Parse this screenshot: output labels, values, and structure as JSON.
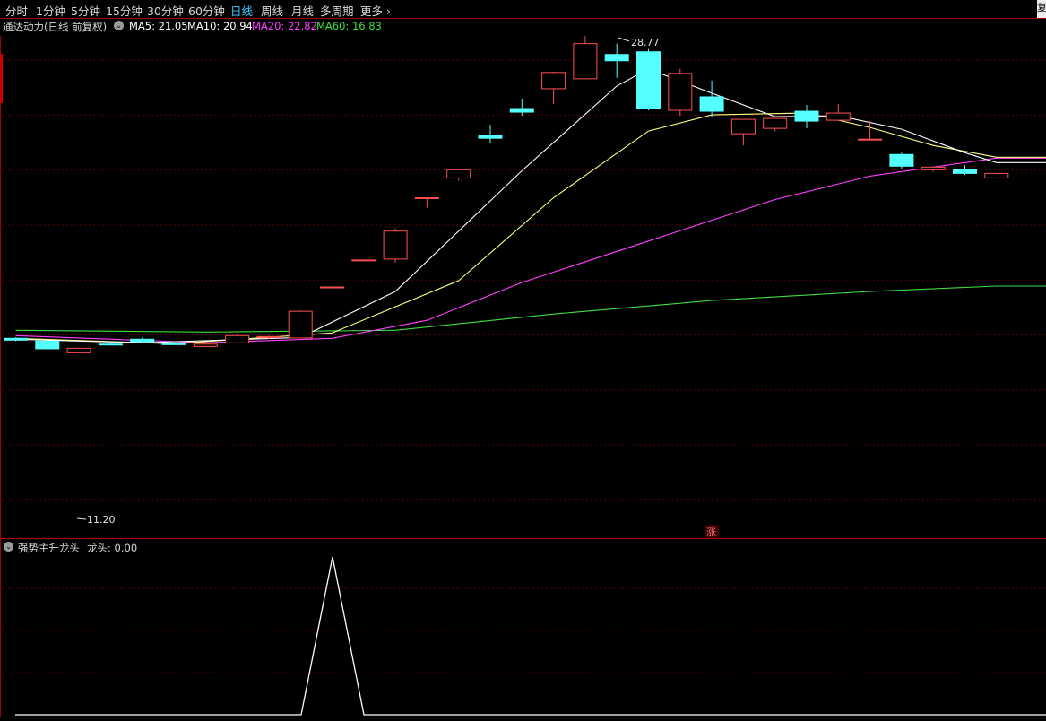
{
  "toolbar": {
    "tabs": [
      "分时",
      "1分钟",
      "5分钟",
      "15分钟",
      "30分钟",
      "60分钟",
      "日线",
      "周线",
      "月线",
      "多周期",
      "更多"
    ],
    "active": "日线",
    "more_chevron": "chevron-right-icon",
    "corner_label": "复"
  },
  "legend": {
    "title": "通达动力(日线 前复权)",
    "toggle_icon": "chevron-down-circle-icon",
    "ma5": "MA5: 21.05",
    "ma10": "MA10: 20.94",
    "ma20": "MA20: 22.82",
    "ma60": "MA60: 16.83"
  },
  "indicator": {
    "title": "强势主升龙头",
    "value": "龙头: 0.00",
    "toggle_icon": "chevron-down-circle-icon"
  },
  "colors": {
    "up": "#ff5050",
    "down": "#54ffff",
    "ma5": "#ffffff",
    "ma10": "#ffff80",
    "ma20": "#ff40ff",
    "ma60": "#40e040",
    "grid": "#5a0000",
    "frame": "#a00000"
  },
  "chart_data": [
    {
      "type": "candlestick",
      "title": "通达动力(日线 前复权)",
      "high_label": "28.77",
      "low_label": "11.20",
      "marker_label": "涨",
      "candles": [
        {
          "o": 12.0,
          "h": 12.05,
          "l": 11.85,
          "c": 11.9
        },
        {
          "o": 11.85,
          "h": 11.9,
          "l": 11.42,
          "c": 11.42
        },
        {
          "o": 11.2,
          "h": 11.48,
          "l": 11.2,
          "c": 11.45
        },
        {
          "o": 11.68,
          "h": 11.72,
          "l": 11.62,
          "c": 11.66
        },
        {
          "o": 11.95,
          "h": 12.05,
          "l": 11.75,
          "c": 11.82
        },
        {
          "o": 11.72,
          "h": 11.75,
          "l": 11.62,
          "c": 11.65
        },
        {
          "o": 11.55,
          "h": 11.72,
          "l": 11.55,
          "c": 11.68
        },
        {
          "o": 11.75,
          "h": 12.2,
          "l": 11.72,
          "c": 12.15
        },
        {
          "o": 12.05,
          "h": 12.15,
          "l": 11.95,
          "c": 12.1
        },
        {
          "o": 12.02,
          "h": 13.55,
          "l": 12.0,
          "c": 13.5
        },
        {
          "o": 14.85,
          "h": 14.85,
          "l": 14.85,
          "c": 14.85
        },
        {
          "o": 16.35,
          "h": 16.35,
          "l": 16.35,
          "c": 16.35
        },
        {
          "o": 16.4,
          "h": 18.1,
          "l": 16.2,
          "c": 17.95
        },
        {
          "o": 19.8,
          "h": 19.8,
          "l": 19.25,
          "c": 19.8
        },
        {
          "o": 20.9,
          "h": 21.4,
          "l": 20.75,
          "c": 21.35
        },
        {
          "o": 23.25,
          "h": 23.85,
          "l": 22.8,
          "c": 23.1
        },
        {
          "o": 24.75,
          "h": 25.3,
          "l": 24.35,
          "c": 24.55
        },
        {
          "o": 25.85,
          "h": 26.8,
          "l": 25.0,
          "c": 26.75
        },
        {
          "o": 26.4,
          "h": 28.77,
          "l": 26.4,
          "c": 28.35
        },
        {
          "o": 27.75,
          "h": 28.35,
          "l": 26.45,
          "c": 27.4
        },
        {
          "o": 27.9,
          "h": 28.05,
          "l": 24.65,
          "c": 24.75
        },
        {
          "o": 24.65,
          "h": 26.95,
          "l": 24.35,
          "c": 26.7
        },
        {
          "o": 25.4,
          "h": 26.3,
          "l": 24.3,
          "c": 24.6
        },
        {
          "o": 23.35,
          "h": 24.1,
          "l": 22.7,
          "c": 24.15
        },
        {
          "o": 23.65,
          "h": 24.2,
          "l": 23.5,
          "c": 24.2
        },
        {
          "o": 24.6,
          "h": 24.95,
          "l": 23.65,
          "c": 24.05
        },
        {
          "o": 24.1,
          "h": 25.0,
          "l": 24.1,
          "c": 24.5
        },
        {
          "o": 23.05,
          "h": 24.05,
          "l": 23.05,
          "c": 23.05
        },
        {
          "o": 22.2,
          "h": 22.3,
          "l": 21.4,
          "c": 21.55
        },
        {
          "o": 21.35,
          "h": 21.55,
          "l": 21.25,
          "c": 21.5
        },
        {
          "o": 21.35,
          "h": 21.6,
          "l": 21.05,
          "c": 21.15
        },
        {
          "o": 20.9,
          "h": 21.15,
          "l": 20.9,
          "c": 21.15
        }
      ],
      "ma5": [
        {
          "i": 0,
          "v": 11.95
        },
        {
          "i": 4,
          "v": 11.75
        },
        {
          "i": 9,
          "v": 12.05
        },
        {
          "i": 12,
          "v": 14.6
        },
        {
          "i": 16,
          "v": 21.3
        },
        {
          "i": 19,
          "v": 26.0
        },
        {
          "i": 20,
          "v": 26.95
        },
        {
          "i": 22,
          "v": 25.6
        },
        {
          "i": 24,
          "v": 24.3
        },
        {
          "i": 26,
          "v": 24.35
        },
        {
          "i": 28,
          "v": 23.6
        },
        {
          "i": 30,
          "v": 22.3
        },
        {
          "i": 31,
          "v": 21.75
        }
      ],
      "ma10": [
        {
          "i": 0,
          "v": 12.0
        },
        {
          "i": 5,
          "v": 11.7
        },
        {
          "i": 10,
          "v": 12.3
        },
        {
          "i": 14,
          "v": 15.2
        },
        {
          "i": 17,
          "v": 19.8
        },
        {
          "i": 20,
          "v": 23.5
        },
        {
          "i": 22,
          "v": 24.4
        },
        {
          "i": 25,
          "v": 24.5
        },
        {
          "i": 27,
          "v": 23.7
        },
        {
          "i": 29,
          "v": 22.7
        },
        {
          "i": 31,
          "v": 22.05
        }
      ],
      "ma20": [
        {
          "i": 0,
          "v": 12.15
        },
        {
          "i": 6,
          "v": 11.75
        },
        {
          "i": 10,
          "v": 12.0
        },
        {
          "i": 13,
          "v": 13.0
        },
        {
          "i": 16,
          "v": 15.1
        },
        {
          "i": 20,
          "v": 17.4
        },
        {
          "i": 24,
          "v": 19.7
        },
        {
          "i": 27,
          "v": 21.0
        },
        {
          "i": 31,
          "v": 22.0
        }
      ],
      "ma60": [
        {
          "i": 0,
          "v": 12.45
        },
        {
          "i": 6,
          "v": 12.35
        },
        {
          "i": 12,
          "v": 12.45
        },
        {
          "i": 17,
          "v": 13.35
        },
        {
          "i": 22,
          "v": 14.1
        },
        {
          "i": 27,
          "v": 14.6
        },
        {
          "i": 31,
          "v": 14.9
        }
      ]
    },
    {
      "type": "line",
      "title": "强势主升龙头",
      "series": [
        {
          "name": "龙头",
          "x": [
            0,
            9,
            10,
            11,
            31
          ],
          "values": [
            0,
            0,
            1,
            0,
            0
          ]
        }
      ]
    }
  ]
}
